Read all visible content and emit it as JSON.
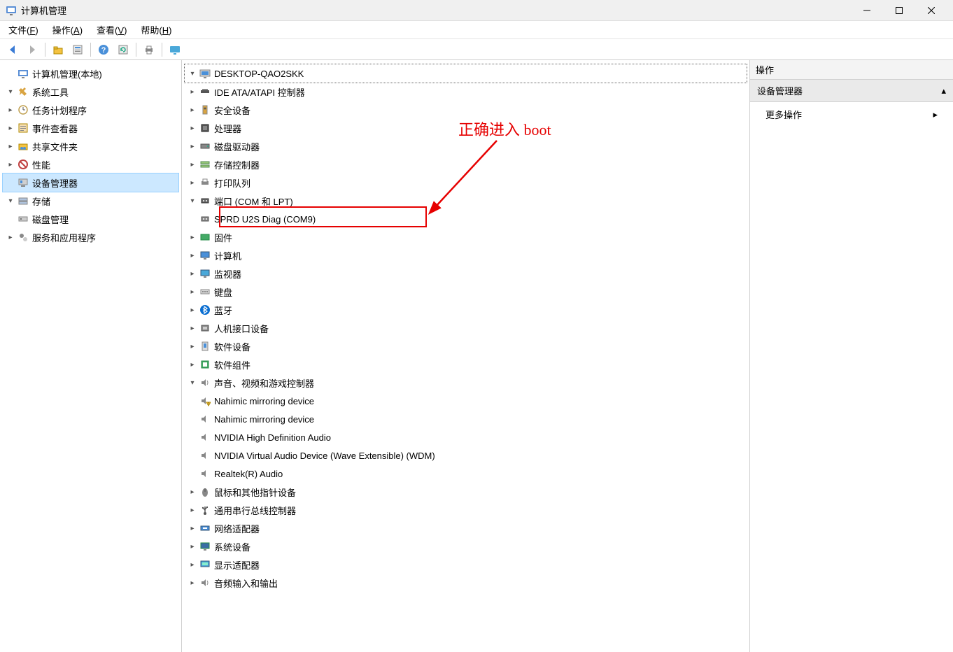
{
  "window": {
    "title": "计算机管理"
  },
  "menu": {
    "file": "文件",
    "file_accel": "F",
    "action": "操作",
    "action_accel": "A",
    "view": "查看",
    "view_accel": "V",
    "help": "帮助",
    "help_accel": "H"
  },
  "left_tree": {
    "root": "计算机管理(本地)",
    "system_tools": "系统工具",
    "task_scheduler": "任务计划程序",
    "event_viewer": "事件查看器",
    "shared_folders": "共享文件夹",
    "performance": "性能",
    "device_manager": "设备管理器",
    "storage": "存储",
    "disk_management": "磁盘管理",
    "services_apps": "服务和应用程序"
  },
  "center_tree": {
    "host": "DESKTOP-QAO2SKK",
    "ide": "IDE ATA/ATAPI 控制器",
    "security": "安全设备",
    "cpu": "处理器",
    "disk": "磁盘驱动器",
    "storage_ctrl": "存储控制器",
    "print_queue": "打印队列",
    "ports": "端口 (COM 和 LPT)",
    "port_child": "SPRD U2S Diag (COM9)",
    "firmware": "固件",
    "computer": "计算机",
    "monitor": "监视器",
    "keyboard": "键盘",
    "bluetooth": "蓝牙",
    "hid": "人机接口设备",
    "software_dev": "软件设备",
    "software_comp": "软件组件",
    "sound": "声音、视频和游戏控制器",
    "sound_c1": "Nahimic mirroring device",
    "sound_c2": "Nahimic mirroring device",
    "sound_c3": "NVIDIA High Definition Audio",
    "sound_c4": "NVIDIA Virtual Audio Device (Wave Extensible) (WDM)",
    "sound_c5": "Realtek(R) Audio",
    "mouse": "鼠标和其他指针设备",
    "usb": "通用串行总线控制器",
    "network": "网络适配器",
    "system_dev": "系统设备",
    "display": "显示适配器",
    "audio_io": "音频输入和输出"
  },
  "right": {
    "header": "操作",
    "sub": "设备管理器",
    "more": "更多操作"
  },
  "annotation": {
    "text": "正确进入 boot"
  }
}
